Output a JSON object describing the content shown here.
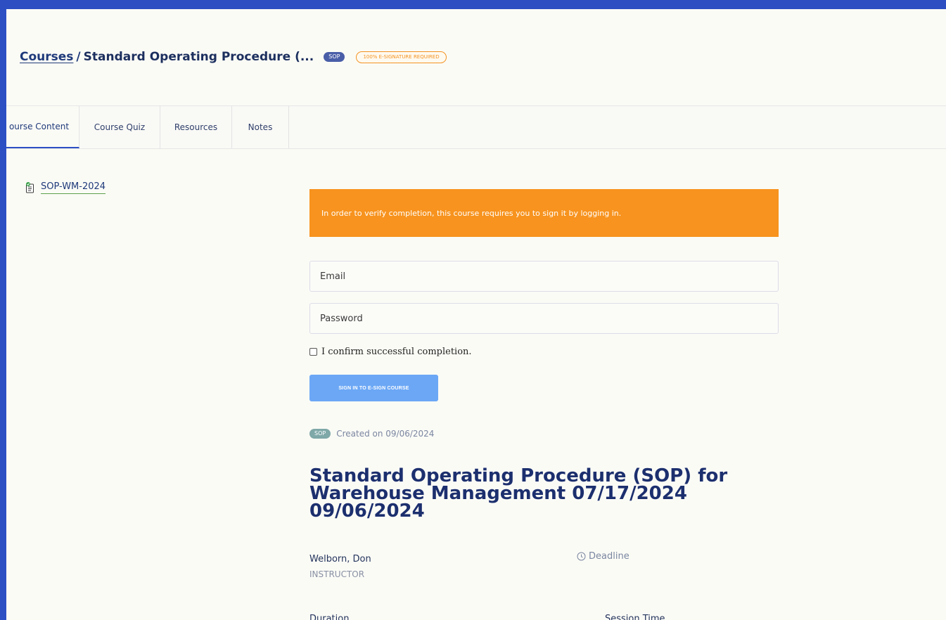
{
  "breadcrumb": {
    "courses_link": "Courses",
    "separator": "/",
    "current": "Standard Operating Procedure (...",
    "badge_sop": "SOP",
    "badge_esignature": "100% E-SIGNATURE REQUIRED"
  },
  "tabs": [
    {
      "label": "ourse Content",
      "active": true
    },
    {
      "label": "Course Quiz",
      "active": false
    },
    {
      "label": "Resources",
      "active": false
    },
    {
      "label": "Notes",
      "active": false
    }
  ],
  "sidebar": {
    "item_label": "SOP-WM-2024",
    "item_icon": "document-check-icon"
  },
  "signature": {
    "alert_text": "In order to verify completion, this course requires you to sign it by logging in.",
    "email_placeholder": "Email",
    "password_placeholder": "Password",
    "confirm_label": "I confirm successful completion.",
    "submit_label": "SIGN IN TO E-SIGN COURSE"
  },
  "course": {
    "badge": "SOP",
    "created": "Created on 09/06/2024",
    "title": "Standard Operating Procedure (SOP) for Warehouse Management 07/17/2024 09/06/2024",
    "instructor_name": "Welborn, Don",
    "instructor_role": "INSTRUCTOR",
    "deadline_label": "Deadline",
    "duration_label": "Duration",
    "session_time_label": "Session Time"
  },
  "colors": {
    "frame_blue": "#2c4fc4",
    "alert_orange": "#f7931e",
    "button_blue": "#6ba7f5",
    "title_navy": "#1c2f6e"
  }
}
